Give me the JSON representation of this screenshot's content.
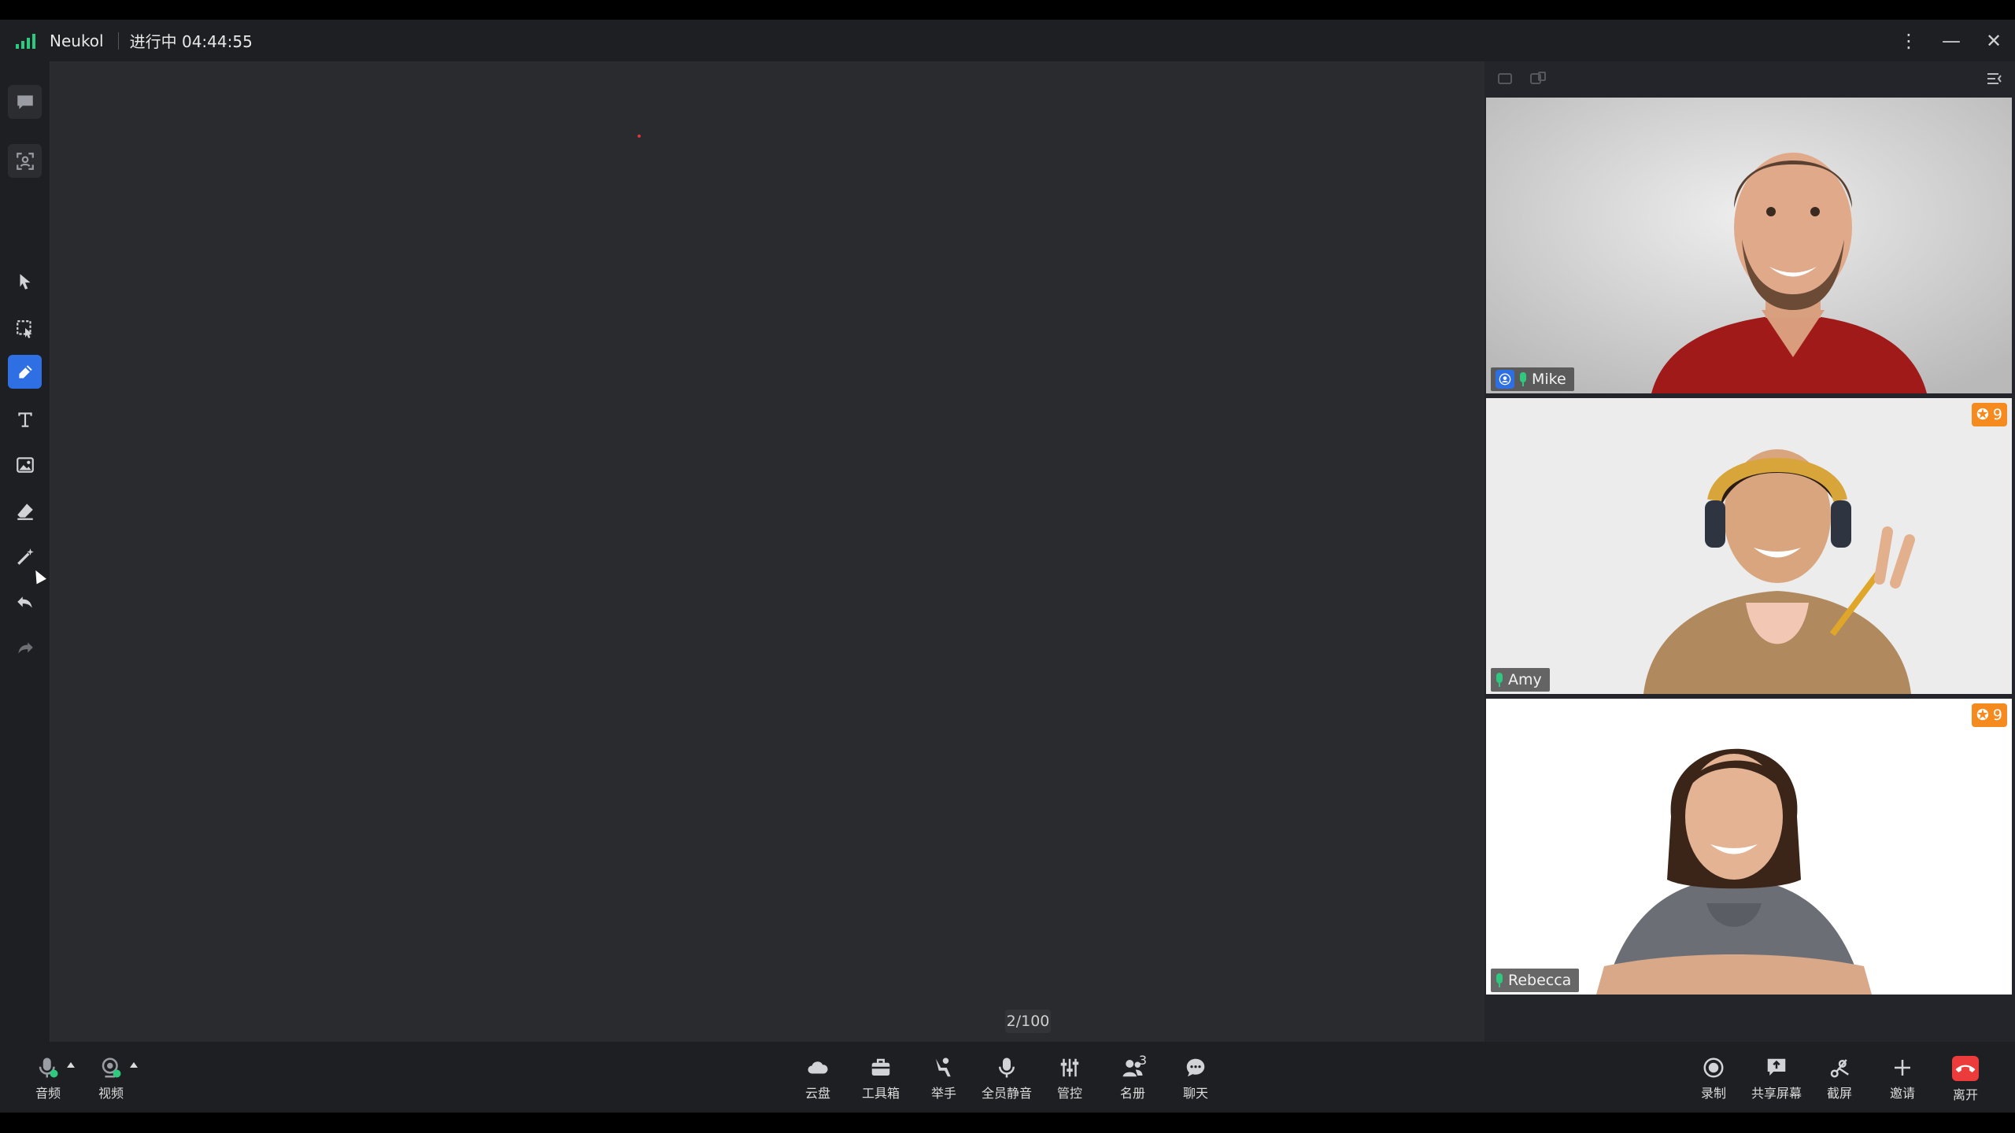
{
  "titlebar": {
    "app_name": "Neukol",
    "status": "进行中 04:44:55",
    "signal_color": "#2ec97e"
  },
  "left_toolbar": {
    "tools": [
      "chat-icon",
      "screenshot-icon",
      "select-arrow-icon",
      "area-select-icon",
      "pen-icon",
      "text-icon",
      "image-icon",
      "eraser-icon",
      "magic-wand-icon",
      "undo-icon",
      "redo-icon"
    ],
    "active_tool": "pen-icon",
    "tooltip": "文本"
  },
  "canvas": {
    "page_indicator": "2/100",
    "background": "#2a2b2f"
  },
  "video_panel": {
    "participants": [
      {
        "name": "Mike",
        "host": true,
        "reward_count": ""
      },
      {
        "name": "Amy",
        "host": false,
        "reward_count": "9"
      },
      {
        "name": "Rebecca",
        "host": false,
        "reward_count": "9"
      }
    ],
    "reward_color": "#f58a1f"
  },
  "bottombar": {
    "left": [
      {
        "label": "音频",
        "icon": "microphone-icon"
      },
      {
        "label": "视频",
        "icon": "camera-icon"
      }
    ],
    "center": [
      {
        "label": "云盘",
        "icon": "cloud-icon"
      },
      {
        "label": "工具箱",
        "icon": "toolbox-icon"
      },
      {
        "label": "举手",
        "icon": "raise-hand-icon"
      },
      {
        "label": "全员静音",
        "icon": "mute-all-icon"
      },
      {
        "label": "管控",
        "icon": "controls-icon"
      },
      {
        "label": "名册",
        "icon": "roster-icon",
        "count": "3"
      },
      {
        "label": "聊天",
        "icon": "chat-icon"
      }
    ],
    "right": [
      {
        "label": "录制",
        "icon": "record-icon"
      },
      {
        "label": "共享屏幕",
        "icon": "share-screen-icon"
      },
      {
        "label": "截屏",
        "icon": "screenshot-icon"
      },
      {
        "label": "邀请",
        "icon": "invite-icon"
      },
      {
        "label": "离开",
        "icon": "leave-icon"
      }
    ],
    "leave_color": "#ec3b3b"
  }
}
